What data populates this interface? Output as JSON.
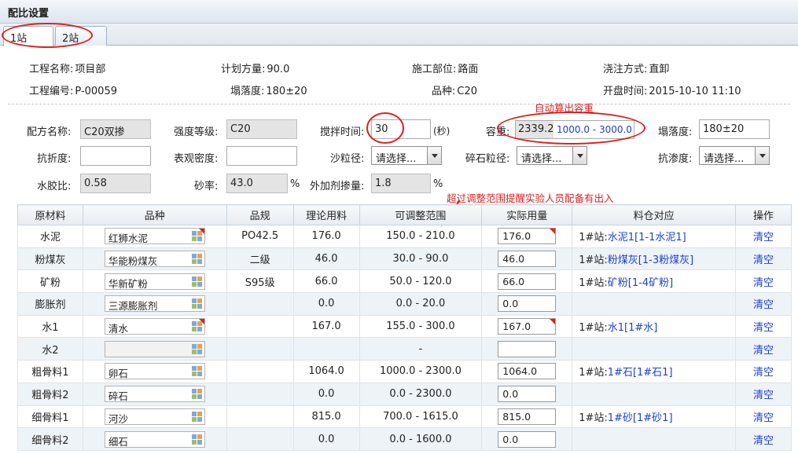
{
  "window": {
    "title": "配比设置"
  },
  "tabs": [
    {
      "label": "1站",
      "active": true
    },
    {
      "label": "2站",
      "active": false
    }
  ],
  "project": {
    "name_label": "工程名称:",
    "name": "项目部",
    "planned_label": "计划方量:",
    "planned": "90.0",
    "part_label": "施工部位:",
    "part": "路面",
    "method_label": "浇注方式:",
    "method": "直卸",
    "code_label": "工程编号:",
    "code": "P-00059",
    "slump_label": "塌落度:",
    "slump": "180±20",
    "variety_label": "品种:",
    "variety": "C20",
    "open_label": "开盘时间:",
    "open_time": "2015-10-10 11:10"
  },
  "form": {
    "recipe_label": "配方名称:",
    "recipe": "C20双掺",
    "strength_label": "强度等级:",
    "strength": "C20",
    "mix_time_label": "搅拌时间:",
    "mix_time": "30",
    "mix_time_unit": "(秒)",
    "weight_label": "容重:",
    "weight": "2339.2",
    "weight_range": "1000.0 - 3000.0",
    "slump_label": "塌落度:",
    "slump": "180±20",
    "fold_label": "抗折度:",
    "fold": "",
    "density_label": "表观密度:",
    "density": "",
    "sand_label": "沙粒径:",
    "sand": "请选择...",
    "gravel_label": "碎石粒径:",
    "gravel": "请选择...",
    "seep_label": "抗渗度:",
    "seep": "请选择...",
    "wb_label": "水胶比:",
    "wb": "0.58",
    "sand_rate_label": "砂率:",
    "sand_rate": "43.0",
    "sand_rate_unit": "%",
    "admix_label": "外加剂掺量:",
    "admix": "1.8",
    "admix_unit": "%"
  },
  "annotations": {
    "auto_weight": "自动算出容重",
    "range_alert": "超过调整范围提醒实验人员配备有出入"
  },
  "colors": {
    "annotation": "#e02020",
    "link": "#1a3fd6"
  },
  "table": {
    "headers": [
      "原材料",
      "品种",
      "品规",
      "理论用料",
      "可调整范围",
      "实际用量",
      "料仓对应",
      "操作"
    ],
    "rows": [
      {
        "material": "水泥",
        "variety": "红狮水泥",
        "flag": true,
        "spec": "PO42.5",
        "theory": "176.0",
        "range": "150.0 - 210.0",
        "actual": "176.0",
        "actual_flag": true,
        "bin_prefix": "1#站:",
        "bin": "水泥1[1-1水泥1]",
        "op": "清空"
      },
      {
        "material": "粉煤灰",
        "variety": "华能粉煤灰",
        "flag": false,
        "spec": "二级",
        "theory": "46.0",
        "range": "30.0 - 90.0",
        "actual": "46.0",
        "actual_flag": false,
        "bin_prefix": "1#站:",
        "bin": "粉煤灰[1-3粉煤灰]",
        "op": "清空"
      },
      {
        "material": "矿粉",
        "variety": "华新矿粉",
        "flag": false,
        "spec": "S95级",
        "theory": "66.0",
        "range": "50.0 - 120.0",
        "actual": "66.0",
        "actual_flag": false,
        "bin_prefix": "1#站:",
        "bin": "矿粉[1-4矿粉]",
        "op": "清空"
      },
      {
        "material": "膨胀剂",
        "variety": "三源膨胀剂",
        "flag": false,
        "spec": "",
        "theory": "0.0",
        "range": "0.0 - 20.0",
        "actual": "0.0",
        "actual_flag": false,
        "bin_prefix": "",
        "bin": "",
        "op": "清空"
      },
      {
        "material": "水1",
        "variety": "清水",
        "flag": true,
        "spec": "",
        "theory": "167.0",
        "range": "155.0 - 300.0",
        "actual": "167.0",
        "actual_flag": true,
        "bin_prefix": "1#站:",
        "bin": "水1[1#水]",
        "op": "清空"
      },
      {
        "material": "水2",
        "variety": "",
        "flag": false,
        "spec": "",
        "theory": "",
        "range": "-",
        "actual": "",
        "actual_flag": false,
        "bin_prefix": "",
        "bin": "",
        "op": "清空"
      },
      {
        "material": "粗骨料1",
        "variety": "卵石",
        "flag": false,
        "spec": "",
        "theory": "1064.0",
        "range": "1000.0 - 2300.0",
        "actual": "1064.0",
        "actual_flag": false,
        "bin_prefix": "1#站:",
        "bin": "1#石[1#石1]",
        "op": "清空"
      },
      {
        "material": "粗骨料2",
        "variety": "碎石",
        "flag": false,
        "spec": "",
        "theory": "0.0",
        "range": "0.0 - 2300.0",
        "actual": "0.0",
        "actual_flag": false,
        "bin_prefix": "",
        "bin": "",
        "op": "清空"
      },
      {
        "material": "细骨料1",
        "variety": "河沙",
        "flag": false,
        "spec": "",
        "theory": "815.0",
        "range": "700.0 - 1615.0",
        "actual": "815.0",
        "actual_flag": false,
        "bin_prefix": "1#站:",
        "bin": "1#砂[1#砂1]",
        "op": "清空"
      },
      {
        "material": "细骨料2",
        "variety": "细石",
        "flag": false,
        "spec": "",
        "theory": "0.0",
        "range": "0.0 - 1600.0",
        "actual": "0.0",
        "actual_flag": false,
        "bin_prefix": "",
        "bin": "",
        "op": "清空"
      }
    ]
  }
}
